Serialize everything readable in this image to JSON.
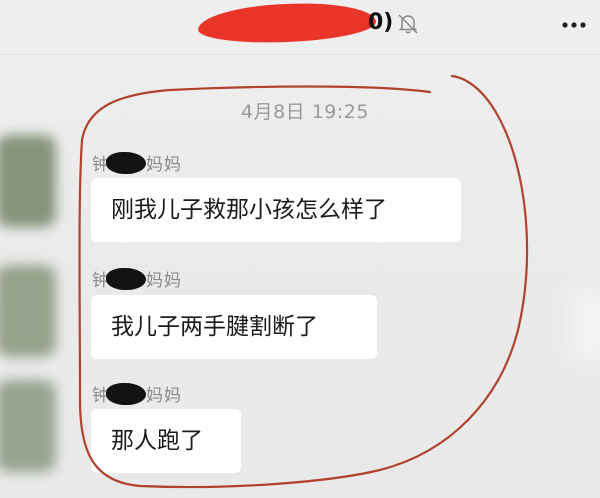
{
  "header": {
    "title_visible_suffix": "0)",
    "mute_icon": "bell-muted-icon",
    "more_icon": "ellipsis-icon"
  },
  "chat": {
    "timestamp": "4月8日 19:25",
    "messages": [
      {
        "sender_prefix": "钟",
        "sender_suffix": "妈妈",
        "text": "刚我儿子救那小孩怎么样了"
      },
      {
        "sender_prefix": "钟",
        "sender_suffix": "妈妈",
        "text": "我儿子两手腱割断了"
      },
      {
        "sender_prefix": "钟",
        "sender_suffix": "妈妈",
        "text": "那人跑了"
      }
    ]
  },
  "colors": {
    "redaction_red": "#e82a1e",
    "annotation_line": "#b0422e",
    "bubble_bg": "#ffffff",
    "chat_bg": "#ececec"
  }
}
